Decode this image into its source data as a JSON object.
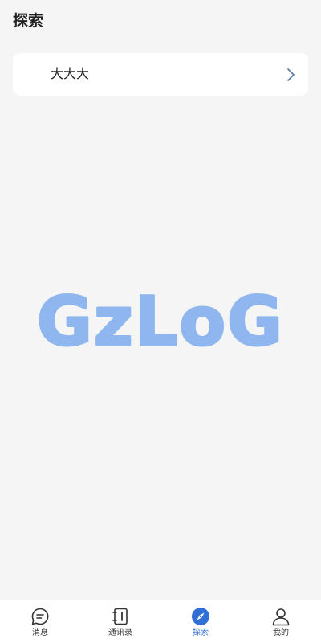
{
  "header": {
    "title": "探索"
  },
  "entries": [
    {
      "label": "大大大",
      "icon": "chevron-right-icon"
    }
  ],
  "watermark": {
    "text": "GzLoG",
    "color": "#8fb6ee"
  },
  "tabbar": {
    "active_color": "#2f6fd6",
    "items": [
      {
        "label": "消息",
        "icon": "message-icon",
        "active": false
      },
      {
        "label": "通讯录",
        "icon": "contacts-icon",
        "active": false
      },
      {
        "label": "探索",
        "icon": "compass-icon",
        "active": true
      },
      {
        "label": "我的",
        "icon": "user-icon",
        "active": false
      }
    ]
  }
}
